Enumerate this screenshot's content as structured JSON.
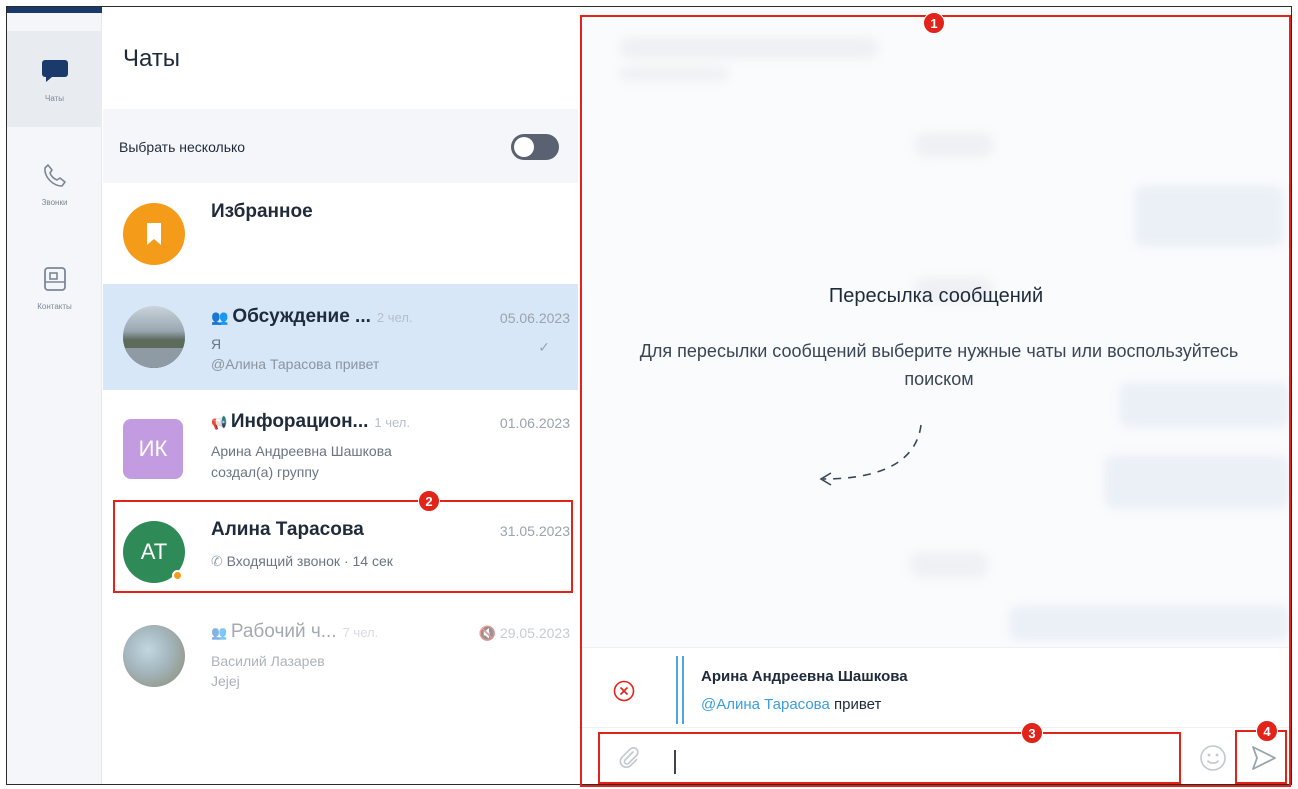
{
  "rail": {
    "items": [
      {
        "label": "Чаты",
        "icon": "chat-bubble-icon",
        "active": true
      },
      {
        "label": "Звонки",
        "icon": "phone-icon",
        "active": false
      },
      {
        "label": "Контакты",
        "icon": "contacts-icon",
        "active": false
      }
    ]
  },
  "list": {
    "title": "Чаты",
    "select_multiple": "Выбрать несколько",
    "chats": [
      {
        "name": "Избранное",
        "avatar_icon": "bookmark-icon",
        "avatar_color": "#f59b1a"
      },
      {
        "name": "Обсуждение ...",
        "members": "2 чел.",
        "date": "05.06.2023",
        "line1": "Я",
        "line2": "@Алина Тарасова привет",
        "type_icon": "group-icon",
        "status_icon": "checkmark-icon"
      },
      {
        "name": "Инфорацион...",
        "members": "1 чел.",
        "date": "01.06.2023",
        "line1": "Арина Андреевна Шашкова",
        "line2": "создал(а) группу",
        "avatar_text": "ИК",
        "avatar_color": "#c39be0",
        "type_icon": "megaphone-icon"
      },
      {
        "name": "Алина Тарасова",
        "date": "31.05.2023",
        "line1": "Входящий звонок · 14 сек",
        "avatar_text": "АТ",
        "avatar_color": "#2e8b57",
        "call_icon": "phone-icon"
      },
      {
        "name": "Рабочий ч...",
        "members": "7 чел.",
        "date": "29.05.2023",
        "line1": "Василий Лазарев",
        "line2": "Jejej",
        "type_icon": "group-icon",
        "mute_icon": "muted-icon"
      }
    ]
  },
  "main": {
    "overlay_title": "Пересылка сообщений",
    "overlay_text": "Для пересылки сообщений выберите нужные чаты или воспользуйтесь поиском",
    "forward": {
      "author": "Арина Андреевна Шашкова",
      "mention": "@Алина Тарасова",
      "message": " привет"
    },
    "compose": {
      "value": "",
      "placeholder": ""
    }
  },
  "annotations": [
    "1",
    "2",
    "3",
    "4"
  ],
  "colors": {
    "accent": "#3b9de0",
    "selected_row": "#d7e7f7",
    "annotation": "#e2231a"
  }
}
